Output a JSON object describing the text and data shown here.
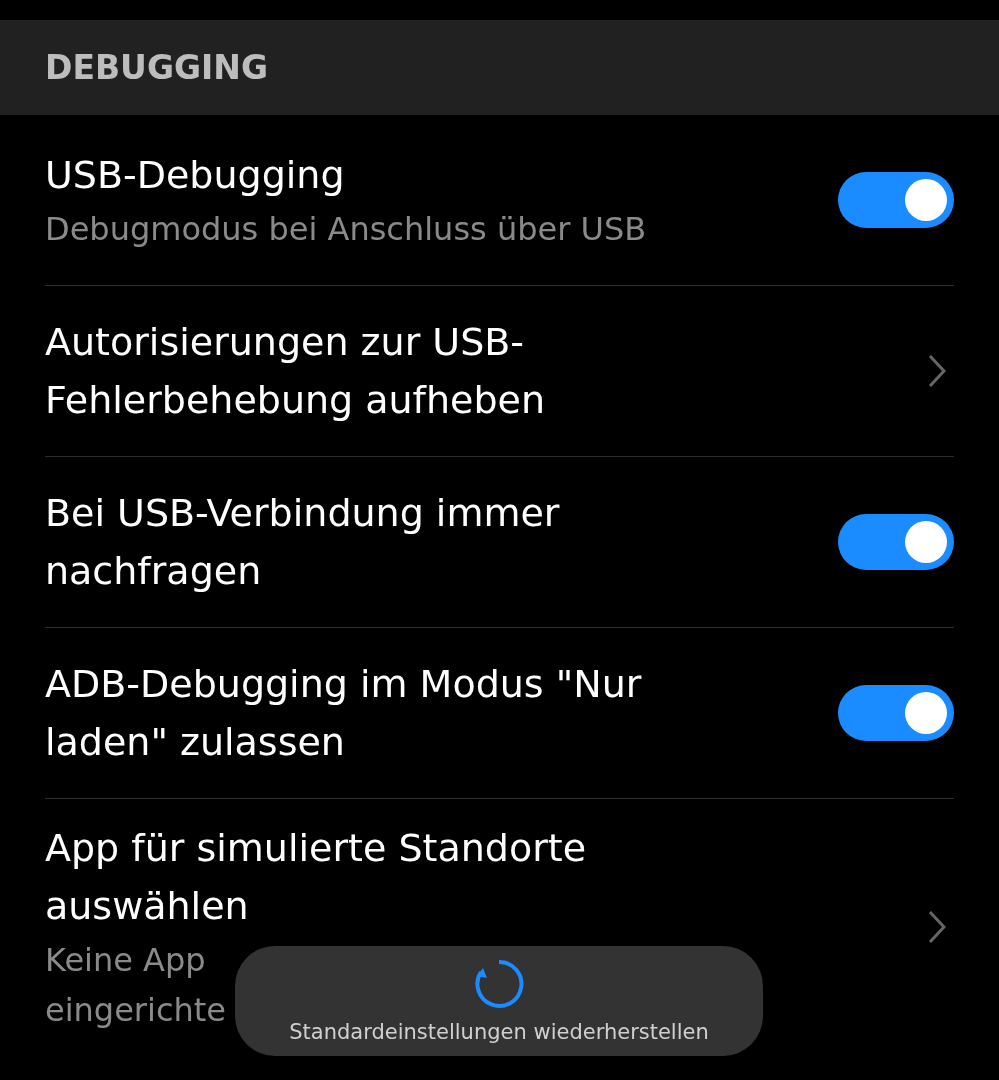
{
  "section": {
    "title": "DEBUGGING"
  },
  "items": [
    {
      "kind": "toggle",
      "title": "USB-Debugging",
      "subtitle": "Debugmodus bei Anschluss über USB",
      "on": true
    },
    {
      "kind": "link",
      "title": "Autorisierungen zur USB-Fehlerbehebung aufheben"
    },
    {
      "kind": "toggle",
      "title": "Bei USB-Verbindung immer nachfragen",
      "on": true
    },
    {
      "kind": "toggle",
      "title": "ADB-Debugging im Modus \"Nur laden\" zulassen",
      "on": true
    },
    {
      "kind": "link",
      "title": "App für simulierte Standorte auswählen",
      "subtitle_lines": [
        "Keine App",
        "eingerichte"
      ]
    }
  ],
  "toast": {
    "text": "Standardeinstellungen wiederherstellen"
  }
}
